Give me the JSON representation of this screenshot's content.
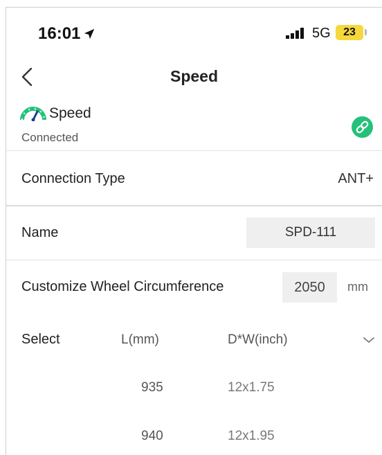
{
  "status_bar": {
    "time": "16:01",
    "network": "5G",
    "battery": "23",
    "battery_color": "#f6d83c"
  },
  "nav": {
    "title": "Speed",
    "back_icon": "chevron-left-icon"
  },
  "sensor": {
    "name": "Speed",
    "status": "Connected",
    "icon": "speedometer-icon",
    "link_icon": "link-icon",
    "accent_color": "#23c17a"
  },
  "connection_type": {
    "label": "Connection Type",
    "value": "ANT+"
  },
  "name_field": {
    "label": "Name",
    "value": "SPD-111"
  },
  "wheel_circumference": {
    "label": "Customize Wheel Circumference",
    "value": "2050",
    "unit": "mm"
  },
  "wheel_select": {
    "label": "Select",
    "col_l": "L(mm)",
    "col_dw": "D*W(inch)",
    "rows": [
      {
        "l": "935",
        "dw": "12x1.75"
      },
      {
        "l": "940",
        "dw": "12x1.95"
      }
    ]
  }
}
